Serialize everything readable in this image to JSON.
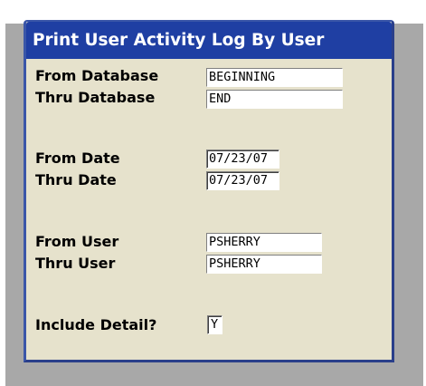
{
  "dialog": {
    "title": "Print User Activity Log By User"
  },
  "fields": {
    "from_database": {
      "label": "From Database",
      "value": "BEGINNING"
    },
    "thru_database": {
      "label": "Thru Database",
      "value": "END"
    },
    "from_date": {
      "label": "From Date",
      "value": "07/23/07"
    },
    "thru_date": {
      "label": "Thru Date",
      "value": "07/23/07"
    },
    "from_user": {
      "label": "From User",
      "value": "PSHERRY"
    },
    "thru_user": {
      "label": "Thru User",
      "value": "PSHERRY"
    },
    "include_detail": {
      "label": "Include Detail?",
      "value": "Y"
    }
  },
  "colors": {
    "titlebar": "#1f3fa3",
    "dialog_background": "#e6e2cc",
    "shadow": "#a8a8a8"
  }
}
